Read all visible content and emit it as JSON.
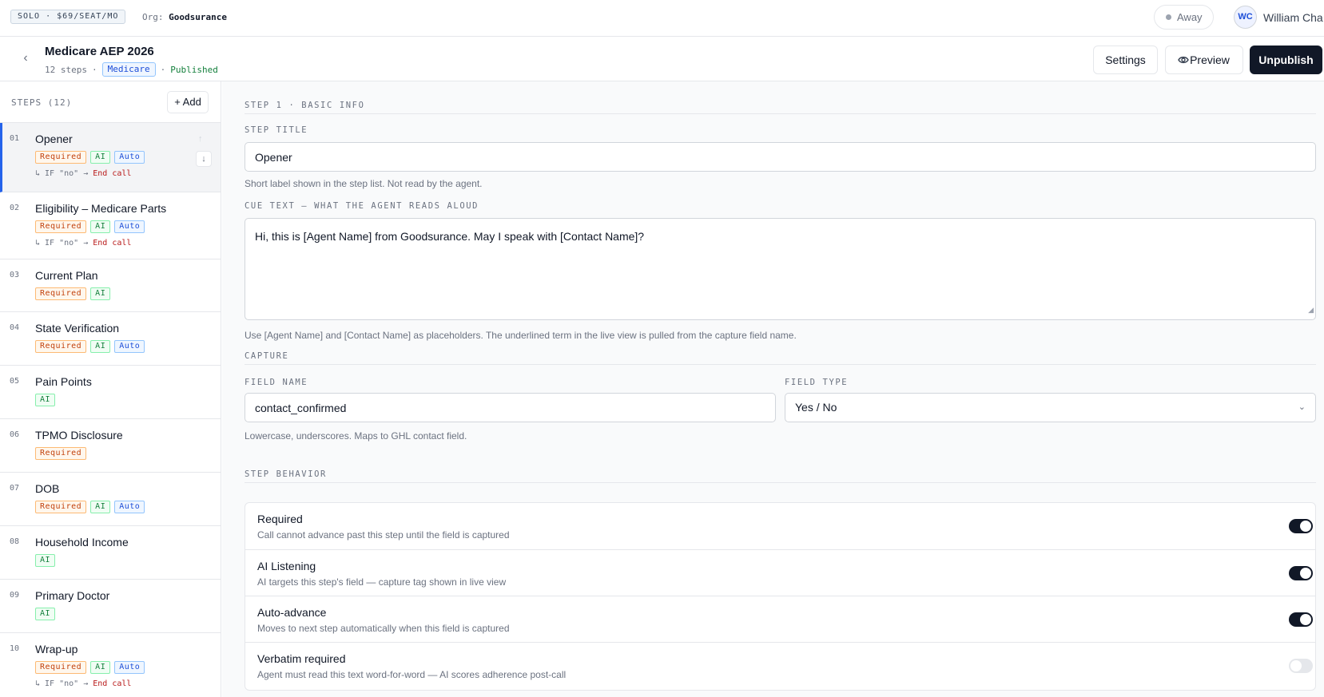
{
  "topbar": {
    "plan": "SOLO · $69/SEAT/MO",
    "org_label": "Org:",
    "org_name": "Goodsurance",
    "status": "Away",
    "avatar_initials": "WC",
    "user_name": "William Cha"
  },
  "header": {
    "title": "Medicare AEP 2026",
    "step_count": "12 steps",
    "sep": "·",
    "tag": "Medicare",
    "status": "Published",
    "settings_label": "Settings",
    "preview_label": "Preview",
    "unpublish_label": "Unpublish"
  },
  "sidebar": {
    "title": "STEPS (12)",
    "add_label": "+ Add",
    "steps": [
      {
        "num": "01",
        "name": "Opener",
        "badges": [
          "Required",
          "AI",
          "Auto"
        ],
        "branch_cond": "↳ IF \"no\" →",
        "branch_target": "End call"
      },
      {
        "num": "02",
        "name": "Eligibility – Medicare Parts",
        "badges": [
          "Required",
          "AI",
          "Auto"
        ],
        "branch_cond": "↳ IF \"no\" →",
        "branch_target": "End call"
      },
      {
        "num": "03",
        "name": "Current Plan",
        "badges": [
          "Required",
          "AI"
        ]
      },
      {
        "num": "04",
        "name": "State Verification",
        "badges": [
          "Required",
          "AI",
          "Auto"
        ]
      },
      {
        "num": "05",
        "name": "Pain Points",
        "badges": [
          "AI"
        ]
      },
      {
        "num": "06",
        "name": "TPMO Disclosure",
        "badges": [
          "Required"
        ]
      },
      {
        "num": "07",
        "name": "DOB",
        "badges": [
          "Required",
          "AI",
          "Auto"
        ]
      },
      {
        "num": "08",
        "name": "Household Income",
        "badges": [
          "AI"
        ]
      },
      {
        "num": "09",
        "name": "Primary Doctor",
        "badges": [
          "AI"
        ]
      },
      {
        "num": "10",
        "name": "Wrap-up",
        "badges": [
          "Required",
          "AI",
          "Auto"
        ],
        "branch_cond": "↳ IF \"no\" →",
        "branch_target": "End call"
      }
    ]
  },
  "main": {
    "section_basic": "STEP 1 · BASIC INFO",
    "step_title_label": "STEP TITLE",
    "step_title_value": "Opener",
    "step_title_help": "Short label shown in the step list. Not read by the agent.",
    "cue_label": "CUE TEXT — WHAT THE AGENT READS ALOUD",
    "cue_value": "Hi, this is [Agent Name] from Goodsurance. May I speak with [Contact Name]?",
    "cue_help": "Use [Agent Name] and [Contact Name] as placeholders. The underlined term in the live view is pulled from the capture field name.",
    "section_capture": "CAPTURE",
    "field_name_label": "FIELD NAME",
    "field_name_value": "contact_confirmed",
    "field_type_label": "FIELD TYPE",
    "field_type_value": "Yes / No",
    "field_help": "Lowercase, underscores. Maps to GHL contact field.",
    "section_behavior": "STEP BEHAVIOR",
    "behaviors": [
      {
        "title": "Required",
        "desc": "Call cannot advance past this step until the field is captured",
        "on": true
      },
      {
        "title": "AI Listening",
        "desc": "AI targets this step's field — capture tag shown in live view",
        "on": true
      },
      {
        "title": "Auto-advance",
        "desc": "Moves to next step automatically when this field is captured",
        "on": true
      },
      {
        "title": "Verbatim required",
        "desc": "Agent must read this text word-for-word — AI scores adherence post-call",
        "on": false
      }
    ]
  },
  "colors": {
    "primary": "#111827",
    "active_accent": "#2563eb",
    "required": "#c2410c",
    "ai": "#15803d",
    "auto": "#1d4ed8",
    "published": "#15803d",
    "end_call": "#b91c1c"
  },
  "icons": {
    "back": "chevron-left-icon",
    "preview": "eye-icon",
    "move_up": "arrow-up-icon",
    "move_down": "arrow-down-icon",
    "select": "chevron-down-icon"
  }
}
